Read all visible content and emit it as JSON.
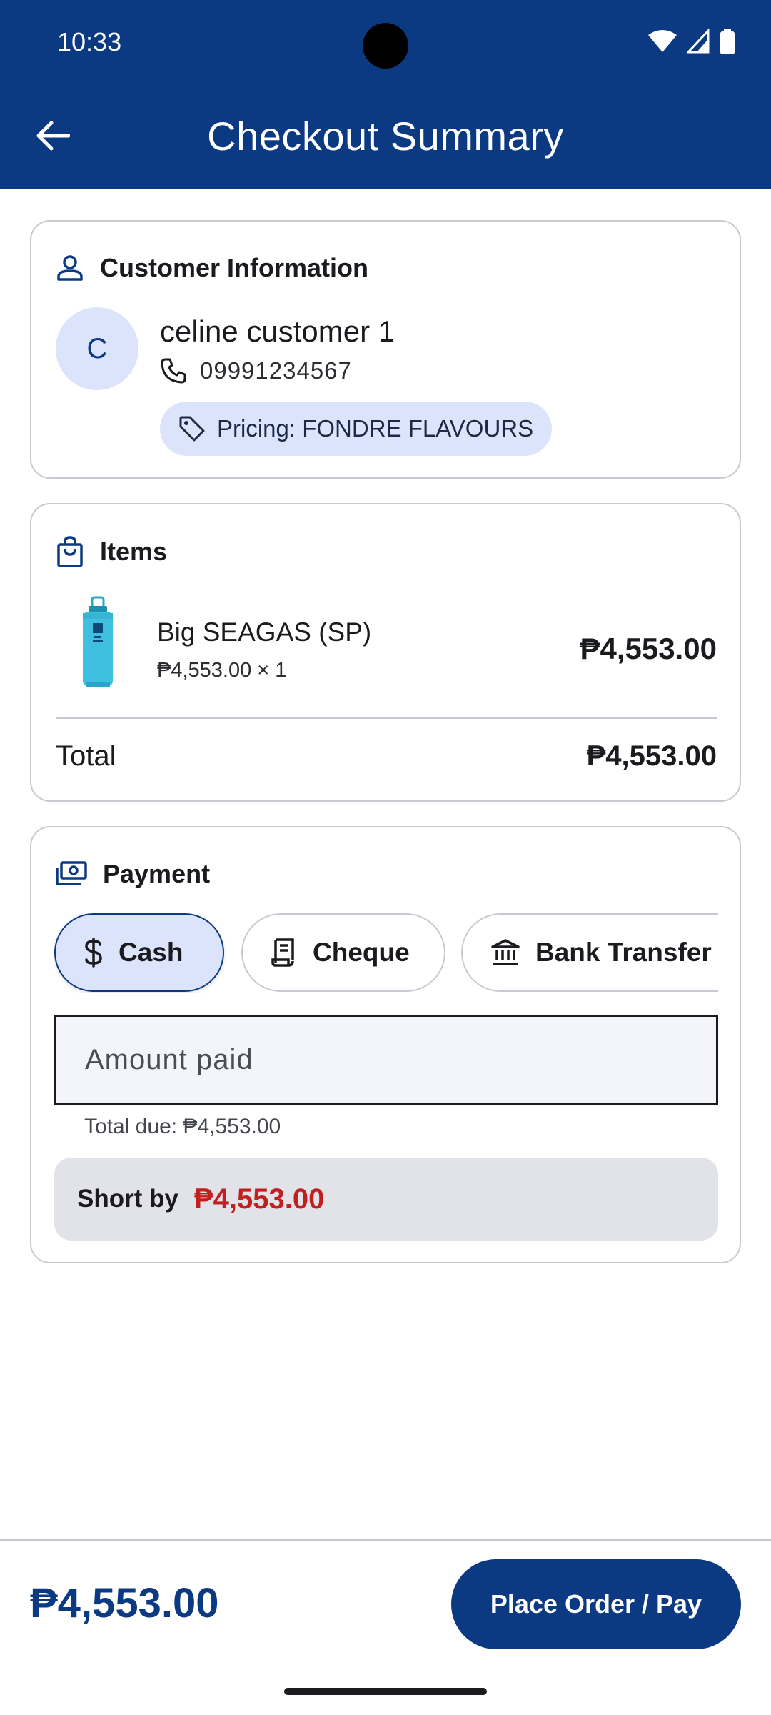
{
  "status_bar": {
    "time": "10:33"
  },
  "header": {
    "title": "Checkout Summary"
  },
  "customer": {
    "section_title": "Customer Information",
    "avatar_initial": "C",
    "name": "celine customer 1",
    "phone": "09991234567",
    "pricing_label": "Pricing: FONDRE FLAVOURS"
  },
  "items": {
    "section_title": "Items",
    "list": [
      {
        "name": "Big SEAGAS (SP)",
        "unit_line": "₱4,553.00 × 1",
        "price": "₱4,553.00"
      }
    ],
    "total_label": "Total",
    "total_value": "₱4,553.00"
  },
  "payment": {
    "section_title": "Payment",
    "methods": [
      {
        "label": "Cash",
        "icon": "dollar-icon",
        "selected": true
      },
      {
        "label": "Cheque",
        "icon": "receipt-icon",
        "selected": false
      },
      {
        "label": "Bank Transfer",
        "icon": "bank-icon",
        "selected": false
      }
    ],
    "amount_placeholder": "Amount paid",
    "helper": "Total due: ₱4,553.00",
    "short_label": "Short by",
    "short_value": "₱4,553.00"
  },
  "footer": {
    "total": "₱4,553.00",
    "action_label": "Place Order / Pay"
  },
  "colors": {
    "primary": "#0b3a82",
    "chip_bg": "#dbe4fb",
    "error": "#c0201f",
    "card_border": "#c9c9d1"
  }
}
